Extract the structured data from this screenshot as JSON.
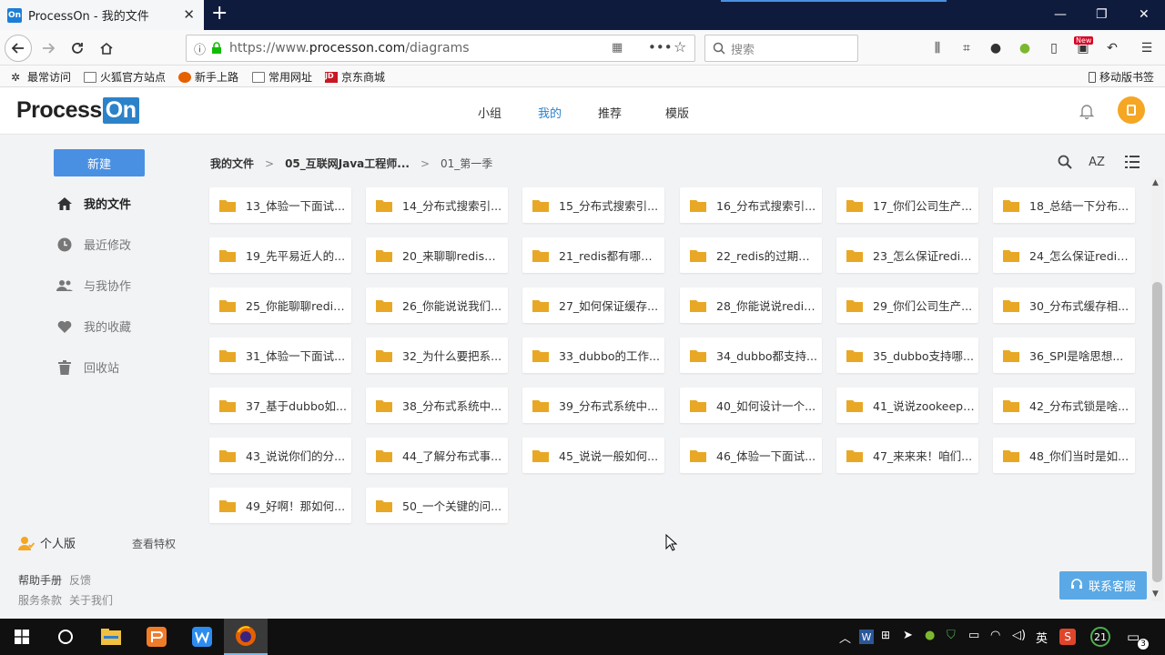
{
  "browser": {
    "tab_title": "ProcessOn - 我的文件",
    "favicon_text": "On",
    "url_prefix": "https://www.",
    "url_domain": "processon.com",
    "url_path": "/diagrams",
    "search_placeholder": "搜索",
    "new_badge": "New",
    "bookmarks": [
      "最常访问",
      "火狐官方站点",
      "新手上路",
      "常用网址",
      "京东商城"
    ],
    "mobile_bookmarks": "移动版书签"
  },
  "app": {
    "logo_main": "Process",
    "logo_on": "On",
    "nav": [
      "小组",
      "我的",
      "推荐",
      "模版"
    ],
    "active_nav": "我的"
  },
  "sidebar": {
    "new_button": "新建",
    "items": [
      {
        "label": "我的文件",
        "icon": "home-icon",
        "active": true
      },
      {
        "label": "最近修改",
        "icon": "clock-icon",
        "active": false
      },
      {
        "label": "与我协作",
        "icon": "people-icon",
        "active": false
      },
      {
        "label": "我的收藏",
        "icon": "heart-icon",
        "active": false
      },
      {
        "label": "回收站",
        "icon": "trash-icon",
        "active": false
      }
    ],
    "plan_label": "个人版",
    "plan_link": "查看特权",
    "footer_links": [
      "帮助手册",
      "反馈",
      "服务条款",
      "关于我们"
    ]
  },
  "breadcrumb": [
    "我的文件",
    "05_互联网Java工程师...",
    "01_第一季"
  ],
  "folders": [
    "13_体验一下面试...",
    "14_分布式搜索引...",
    "15_分布式搜索引...",
    "16_分布式搜索引...",
    "17_你们公司生产...",
    "18_总结一下分布...",
    "19_先平易近人的...",
    "20_来聊聊redis的...",
    "21_redis都有哪些...",
    "22_redis的过期策...",
    "23_怎么保证redis...",
    "24_怎么保证redis...",
    "25_你能聊聊redis...",
    "26_你能说说我们...",
    "27_如何保证缓存...",
    "28_你能说说redis...",
    "29_你们公司生产...",
    "30_分布式缓存相...",
    "31_体验一下面试...",
    "32_为什么要把系...",
    "33_dubbo的工作...",
    "34_dubbo都支持...",
    "35_dubbo支持哪...",
    "36_SPI是啥思想...",
    "37_基于dubbo如...",
    "38_分布式系统中...",
    "39_分布式系统中...",
    "40_如何设计一个...",
    "41_说说zookeepe...",
    "42_分布式锁是啥...",
    "43_说说你们的分...",
    "44_了解分布式事...",
    "45_说说一般如何...",
    "46_体验一下面试...",
    "47_来来来！咱们...",
    "48_你们当时是如...",
    "49_好啊！那如何...",
    "50_一个关键的问..."
  ],
  "service_button": "联系客服",
  "taskbar": {
    "ime": "英",
    "notification_count": "21",
    "action_center_badge": "3"
  },
  "colors": {
    "accent": "#4a90e2",
    "folder": "#e8a825",
    "brand_on": "#2c82c9",
    "avatar": "#f5a623"
  }
}
